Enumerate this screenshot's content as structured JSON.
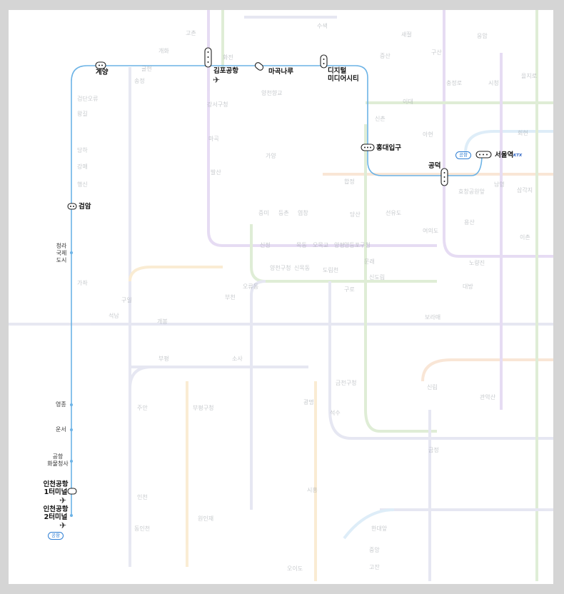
{
  "map": {
    "line_color": "#6cb3e6",
    "background_line_colors": [
      "#c9b2e6",
      "#f2c9a6",
      "#b9d9a6",
      "#c9cce3",
      "#f4d7a0",
      "#b8d8f0"
    ],
    "main_stations": {
      "gyeyang": "계양",
      "gimpo_airport": "김포공항",
      "magongnaru": "마곡나루",
      "dmc_line1": "디지털",
      "dmc_line2": "미디어시티",
      "hongik": "홍대입구",
      "gongdeok": "공덕",
      "seoul_station": "서울역",
      "geomam": "검암",
      "incheon_t1_line1": "인천공항",
      "incheon_t1_line2": "1터미널",
      "incheon_t2_line1": "인천공항",
      "incheon_t2_line2": "2터미널"
    },
    "small_stations": {
      "cheongna_1": "청라",
      "cheongna_2": "국제",
      "cheongna_3": "도시",
      "yeongjong": "영종",
      "unseo": "운서",
      "cargo_1": "공항",
      "cargo_2": "화물청사"
    },
    "tags": {
      "airport_tag": "공항",
      "ktx_mark": "KTX"
    },
    "background_labels": {
      "yeongdeungpo": "영등포구청",
      "hapjeong": "합정",
      "dangsan": "당산",
      "bupyeong": "부평",
      "bucheon": "부천",
      "guro": "구로",
      "sindorim": "신도림",
      "yeouido": "여의도",
      "noryangjin": "노량진",
      "sinchon": "신촌",
      "chungjeongno": "충정로",
      "sicheong": "시청",
      "euljiro": "을지로",
      "samgakji": "삼각지",
      "yongsan": "용산",
      "daebang": "대방",
      "boramae": "보라매",
      "guil": "구일",
      "gaebong": "개봉",
      "oryu": "오류동",
      "sosa": "소사",
      "juan": "주안",
      "geumcheon": "금천구청",
      "gwangmyeong": "광명",
      "sillim": "신림",
      "gwanaksan": "관악산",
      "seoksu": "석수",
      "geumjeong": "금정",
      "ansan": "안산",
      "jungang": "중앙",
      "hanyang": "한대앞",
      "gojan": "고잔",
      "oido": "오이도",
      "siheung": "시흥",
      "woninjae": "원인재",
      "incheon": "인천",
      "dongincheon": "동인천",
      "bupyeong_gu": "부평구청",
      "gyeyang_bg": "귤현",
      "sindorim2": "신도림",
      "ichon": "이촌",
      "ewha": "이대",
      "ahyeon": "아현",
      "gangseo": "강서구청",
      "magok": "마곡",
      "balsan": "발산",
      "songjeong": "송정",
      "gaehwa": "개화",
      "gimpo_gold": "고촌",
      "geomdan": "검단오류",
      "wanggil": "왕길",
      "dangha": "당하",
      "seokbu": "석남",
      "gajwa": "가좌",
      "sinjeong": "신정",
      "mokdong": "목동",
      "omokgyo": "오목교",
      "yangpyeong": "양평",
      "mullae": "문래",
      "dorimcheon": "도림천",
      "yangcheon": "양천구청",
      "sinmokdong": "신목동",
      "yeomchang": "염창",
      "deungchon": "등촌",
      "jeungmi": "증미",
      "gayang": "가양",
      "yangcheonhyang": "양천향교",
      "seonyudo": "선유도",
      "sinbanpo": "신반포",
      "noksapyeong": "녹사평",
      "seobinggo": "서빙고",
      "hangangjin": "한강진",
      "itaewon": "이태원",
      "hyochang": "효창공원앞",
      "namyeong": "남영",
      "hoehyeon": "회현",
      "myeongdong": "명동",
      "jonggak": "종각",
      "jongno3": "종로3가",
      "anguk": "안국",
      "gwanghwamun": "광화문",
      "gyeongbokgung": "경복궁",
      "dokrip": "독립문",
      "muakjae": "무악재",
      "hongje": "홍제",
      "seodaemun": "서대문",
      "sinsa": "신사",
      "nokbeon": "녹번",
      "bulgwang": "불광",
      "yeonsinnae": "연신내",
      "gusan": "구산",
      "eungam": "응암",
      "saejeol": "새절",
      "jeungsan": "증산",
      "susaek": "수색",
      "hwajeon": "화전",
      "gangmae": "강매",
      "haengsin": "행신",
      "neunggok": "능곡",
      "daegok": "대곡"
    }
  }
}
